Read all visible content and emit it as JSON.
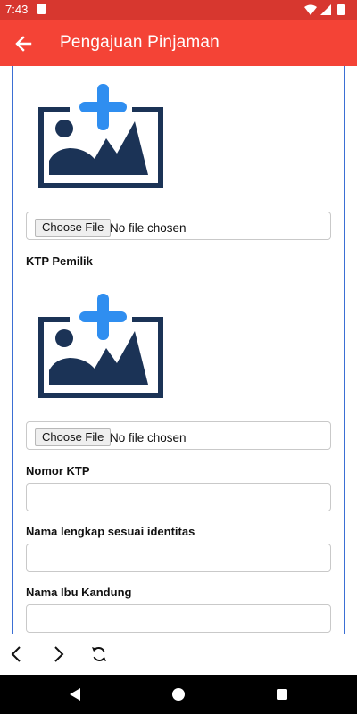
{
  "status_bar": {
    "time": "7:43"
  },
  "app_bar": {
    "title": "Pengajuan Pinjaman"
  },
  "form": {
    "upload_1": {
      "button_label": "Choose File",
      "status_text": "No file chosen"
    },
    "ktp_owner_label": "KTP Pemilik",
    "upload_2": {
      "button_label": "Choose File",
      "status_text": "No file chosen"
    },
    "ktp_number_label": "Nomor KTP",
    "full_name_label": "Nama lengkap sesuai identitas",
    "mother_name_label": "Nama Ibu Kandung"
  },
  "colors": {
    "status_bar": "#d7372f",
    "app_bar": "#f44336",
    "frame_line": "#3b6fd4",
    "image_icon_dark": "#1b3356",
    "image_icon_plus": "#2f8ef0"
  },
  "icons": [
    "arrow-left-icon",
    "image-add-icon",
    "chevron-left-icon",
    "chevron-right-icon",
    "refresh-icon",
    "back-triangle-icon",
    "home-circle-icon",
    "recents-square-icon"
  ]
}
